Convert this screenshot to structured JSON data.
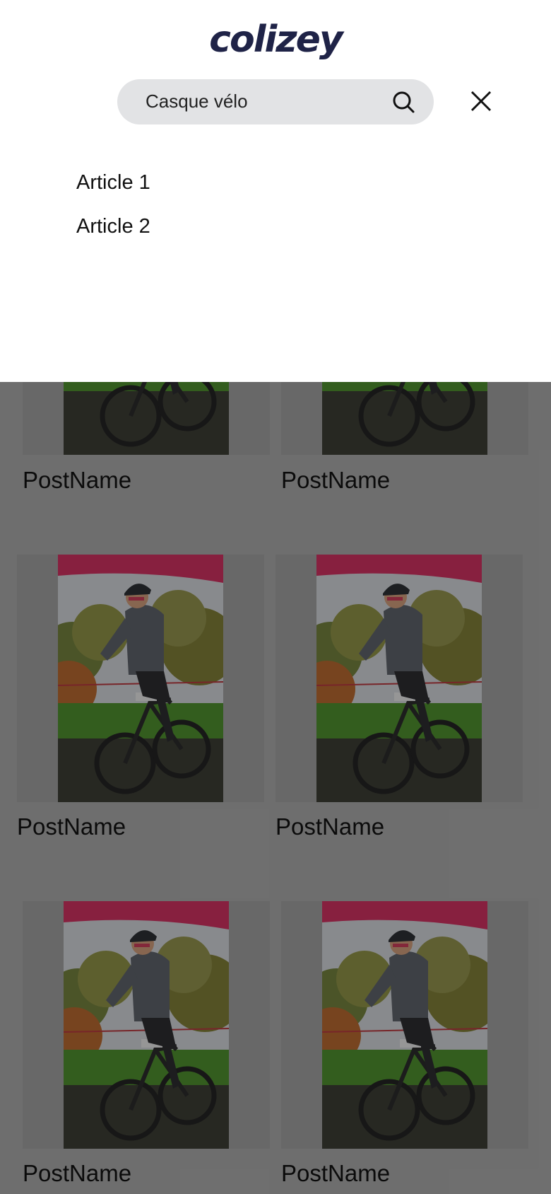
{
  "header": {
    "logo_text": "colizey"
  },
  "search": {
    "value": "Casque vélo",
    "placeholder": ""
  },
  "results": [
    {
      "label": "Article 1"
    },
    {
      "label": "Article 2"
    }
  ],
  "posts": [
    {
      "name": "PostName"
    },
    {
      "name": "PostName"
    },
    {
      "name": "PostName"
    },
    {
      "name": "PostName"
    },
    {
      "name": "PostName"
    },
    {
      "name": "PostName"
    }
  ],
  "colors": {
    "logo": "#1f2347",
    "search_bg": "#e2e3e5",
    "backdrop": "#a3a3a3",
    "jersey": "#5a5f66",
    "banner": "#d9406e"
  }
}
